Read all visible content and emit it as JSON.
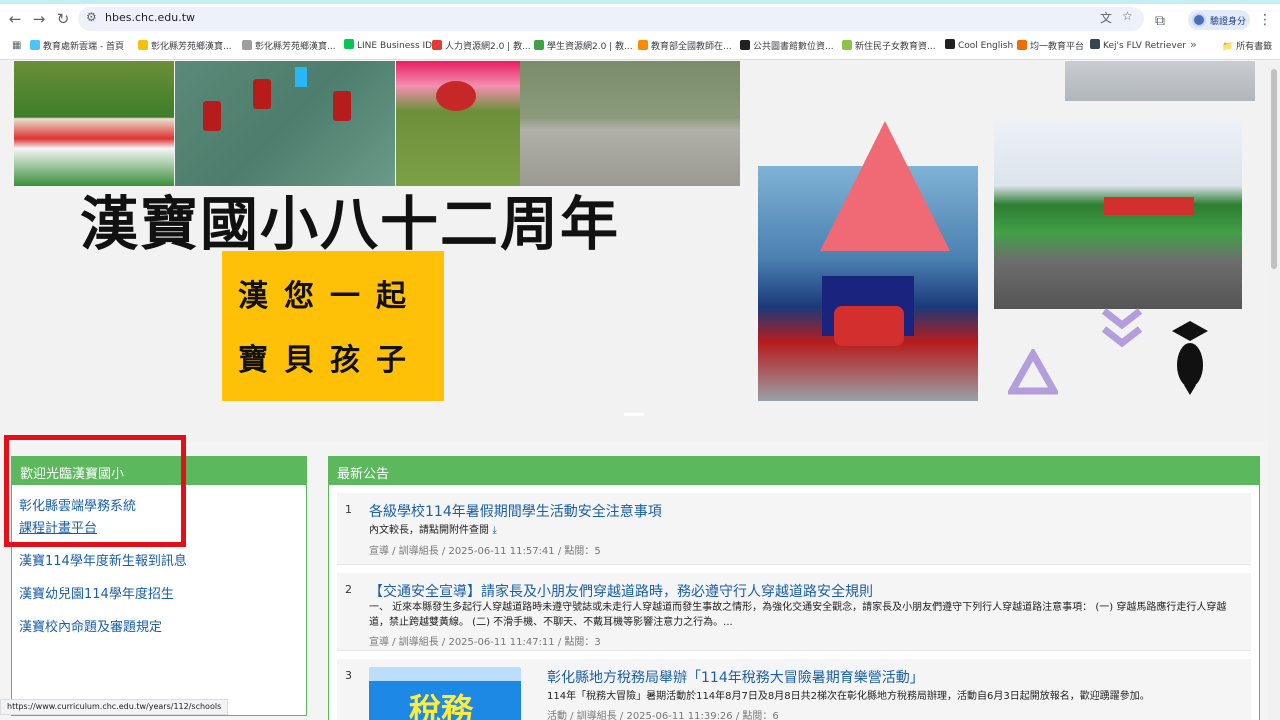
{
  "browser": {
    "url": "hbes.chc.edu.tw",
    "profile_label": "驗證身分",
    "status_url": "https://www.curriculum.chc.edu.tw/years/112/schools",
    "bookmarks": [
      {
        "label": "教育處新雲端 - 首頁",
        "color": "#4fc3f7"
      },
      {
        "label": "彰化縣芳苑鄉漢寶...",
        "color": "#f4c20d"
      },
      {
        "label": "彰化縣芳苑鄉漢寶...",
        "color": "#9e9e9e"
      },
      {
        "label": "LINE Business ID",
        "color": "#06c755"
      },
      {
        "label": "人力資源網2.0 | 教...",
        "color": "#e53935"
      },
      {
        "label": "學生資源網2.0 | 教...",
        "color": "#43a047"
      },
      {
        "label": "教育部全國教師在...",
        "color": "#fb8c00"
      },
      {
        "label": "公共圖書館數位資...",
        "color": "#212121"
      },
      {
        "label": "新住民子女教育資...",
        "color": "#8bc34a"
      },
      {
        "label": "Cool English",
        "color": "#212121"
      },
      {
        "label": "均一教育平台",
        "color": "#ef6c00"
      },
      {
        "label": "Kej's FLV Retriever",
        "color": "#37474f"
      }
    ],
    "bookmarks_all": "所有書籤"
  },
  "banner": {
    "headline": "漢寶國小八十二周年",
    "slogan_line1": "漢您一起",
    "slogan_line2": "寶貝孩子"
  },
  "welcome_panel": {
    "title": "歡迎光臨漢寶國小",
    "links": [
      "彰化縣雲端學務系統",
      "課程計畫平台",
      "漢寶114學年度新生報到訊息",
      "漢寶幼兒園114學年度招生",
      "漢寶校內命題及審題規定"
    ]
  },
  "news_panel": {
    "title": "最新公告",
    "items": [
      {
        "num": "1",
        "title": "各級學校114年暑假期間學生活動安全注意事項",
        "desc": "內文較長，請點開附件查閱",
        "meta": "宣導 / 訓導組長 / 2025-06-11 11:57:41 / 點閱：5"
      },
      {
        "num": "2",
        "title": "【交通安全宣導】請家長及小朋友們穿越道路時，務必遵守行人穿越道路安全規則",
        "desc": "一、 近來本縣發生多起行人穿越道路時未遵守號誌或未走行人穿越道而發生事故之情形，為強化交通安全觀念，請家長及小朋友們遵守下列行人穿越道路注意事項： (一) 穿越馬路應行走行人穿越道，禁止跨越雙黃線。 (二) 不滑手機、不聊天、不戴耳機等影響注意力之行為。...",
        "meta": "宣導 / 訓導組長 / 2025-06-11 11:47:11 / 點閱：3"
      },
      {
        "num": "3",
        "title": "彰化縣地方稅務局舉辦「114年稅務大冒險暑期育樂營活動」",
        "desc": "114年「稅務大冒險」暑期活動於114年8月7日及8月8日共2梯次在彰化縣地方稅務局辦理，活動自6月3日起開放報名，歡迎踴躍參加。",
        "meta": "活動 / 訓導組長 / 2025-06-11 11:39:26 / 點閱：6",
        "thumb_text": "稅務"
      }
    ]
  }
}
